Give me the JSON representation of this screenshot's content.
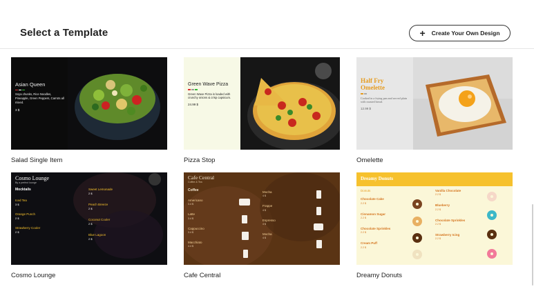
{
  "header": {
    "title": "Select a Template",
    "create_button": "Create Your Own Design",
    "create_icon": "plus-icon"
  },
  "templates": [
    {
      "name": "Salad Single Item",
      "menu_title": "Asian Queen",
      "desc": "Soya chunks, Rice Noodles, Pineapple, Green Peppers, Carrots all mixed.",
      "price": "3 $"
    },
    {
      "name": "Pizza Stop",
      "menu_title": "Green Wave Pizza",
      "desc": "Green Wave Pizza is loaded with crunchy onions & crisp capsicum.",
      "price": "24.99 $"
    },
    {
      "name": "Omelette",
      "menu_title_1": "Half Fry",
      "menu_title_2": "Omelette",
      "desc": "Cooked in a frying pan and served plain with roasted bread.",
      "price": "12.99 $"
    },
    {
      "name": "Cosmo Lounge",
      "menu_title": "Cosmo Lounge",
      "subtitle": "By a perfect lounge",
      "section": "Mocktails",
      "items": [
        {
          "name": "Iced Tea",
          "price": "3 $"
        },
        {
          "name": "Orange Punch",
          "price": "2 $"
        },
        {
          "name": "Strawberry Cooler",
          "price": "2 $"
        },
        {
          "name": "Sweet Lemonade",
          "price": "2 $"
        },
        {
          "name": "Peach Breeze",
          "price": "2 $"
        },
        {
          "name": "Coconut Cooler",
          "price": "2 $"
        },
        {
          "name": "Blue Lagoon",
          "price": "2 $"
        }
      ]
    },
    {
      "name": "Cafe Central",
      "menu_title": "Cafe Central",
      "subtitle": "Coffee & Tea",
      "section": "Coffee",
      "items": [
        {
          "name": "Americano",
          "price": "3.4 $"
        },
        {
          "name": "Latte",
          "price": "3.4 $"
        },
        {
          "name": "Cappuccino",
          "price": "3.4 $"
        },
        {
          "name": "Macchiato",
          "price": "4.4 $"
        },
        {
          "name": "Mocha",
          "price": "4 $"
        },
        {
          "name": "Frappe",
          "price": "4 $"
        },
        {
          "name": "Espresso",
          "price": "4 $"
        },
        {
          "name": "Mocha",
          "price": "4 $"
        }
      ]
    },
    {
      "name": "Dreamy Donuts",
      "menu_title": "Dreamy Donuts",
      "section": "Donuts",
      "items": [
        {
          "name": "Chocolate Cake",
          "price": "2.2 $"
        },
        {
          "name": "Cinnamon Sugar",
          "price": "2.2 $"
        },
        {
          "name": "Chocolate Sprinkles",
          "price": "2.2 $"
        },
        {
          "name": "Cream Puff",
          "price": "2.2 $"
        },
        {
          "name": "Vanilla Chocolate",
          "price": "2.2 $"
        },
        {
          "name": "Blueberry",
          "price": "2.2 $"
        },
        {
          "name": "Chocolate Sprinkles",
          "price": "2.2 $"
        },
        {
          "name": "Strawberry Icing",
          "price": "2.2 $"
        }
      ]
    }
  ],
  "colors": {
    "dark_panel": "#0b0b0b",
    "pizza_panel": "#f7f9e6",
    "omelette_panel": "#e7e7e7",
    "omelette_title": "#e69b1e",
    "cafe_bg": "#5a3414",
    "donut_bar": "#f6c12d",
    "donut_bg": "#fbf7d8"
  }
}
